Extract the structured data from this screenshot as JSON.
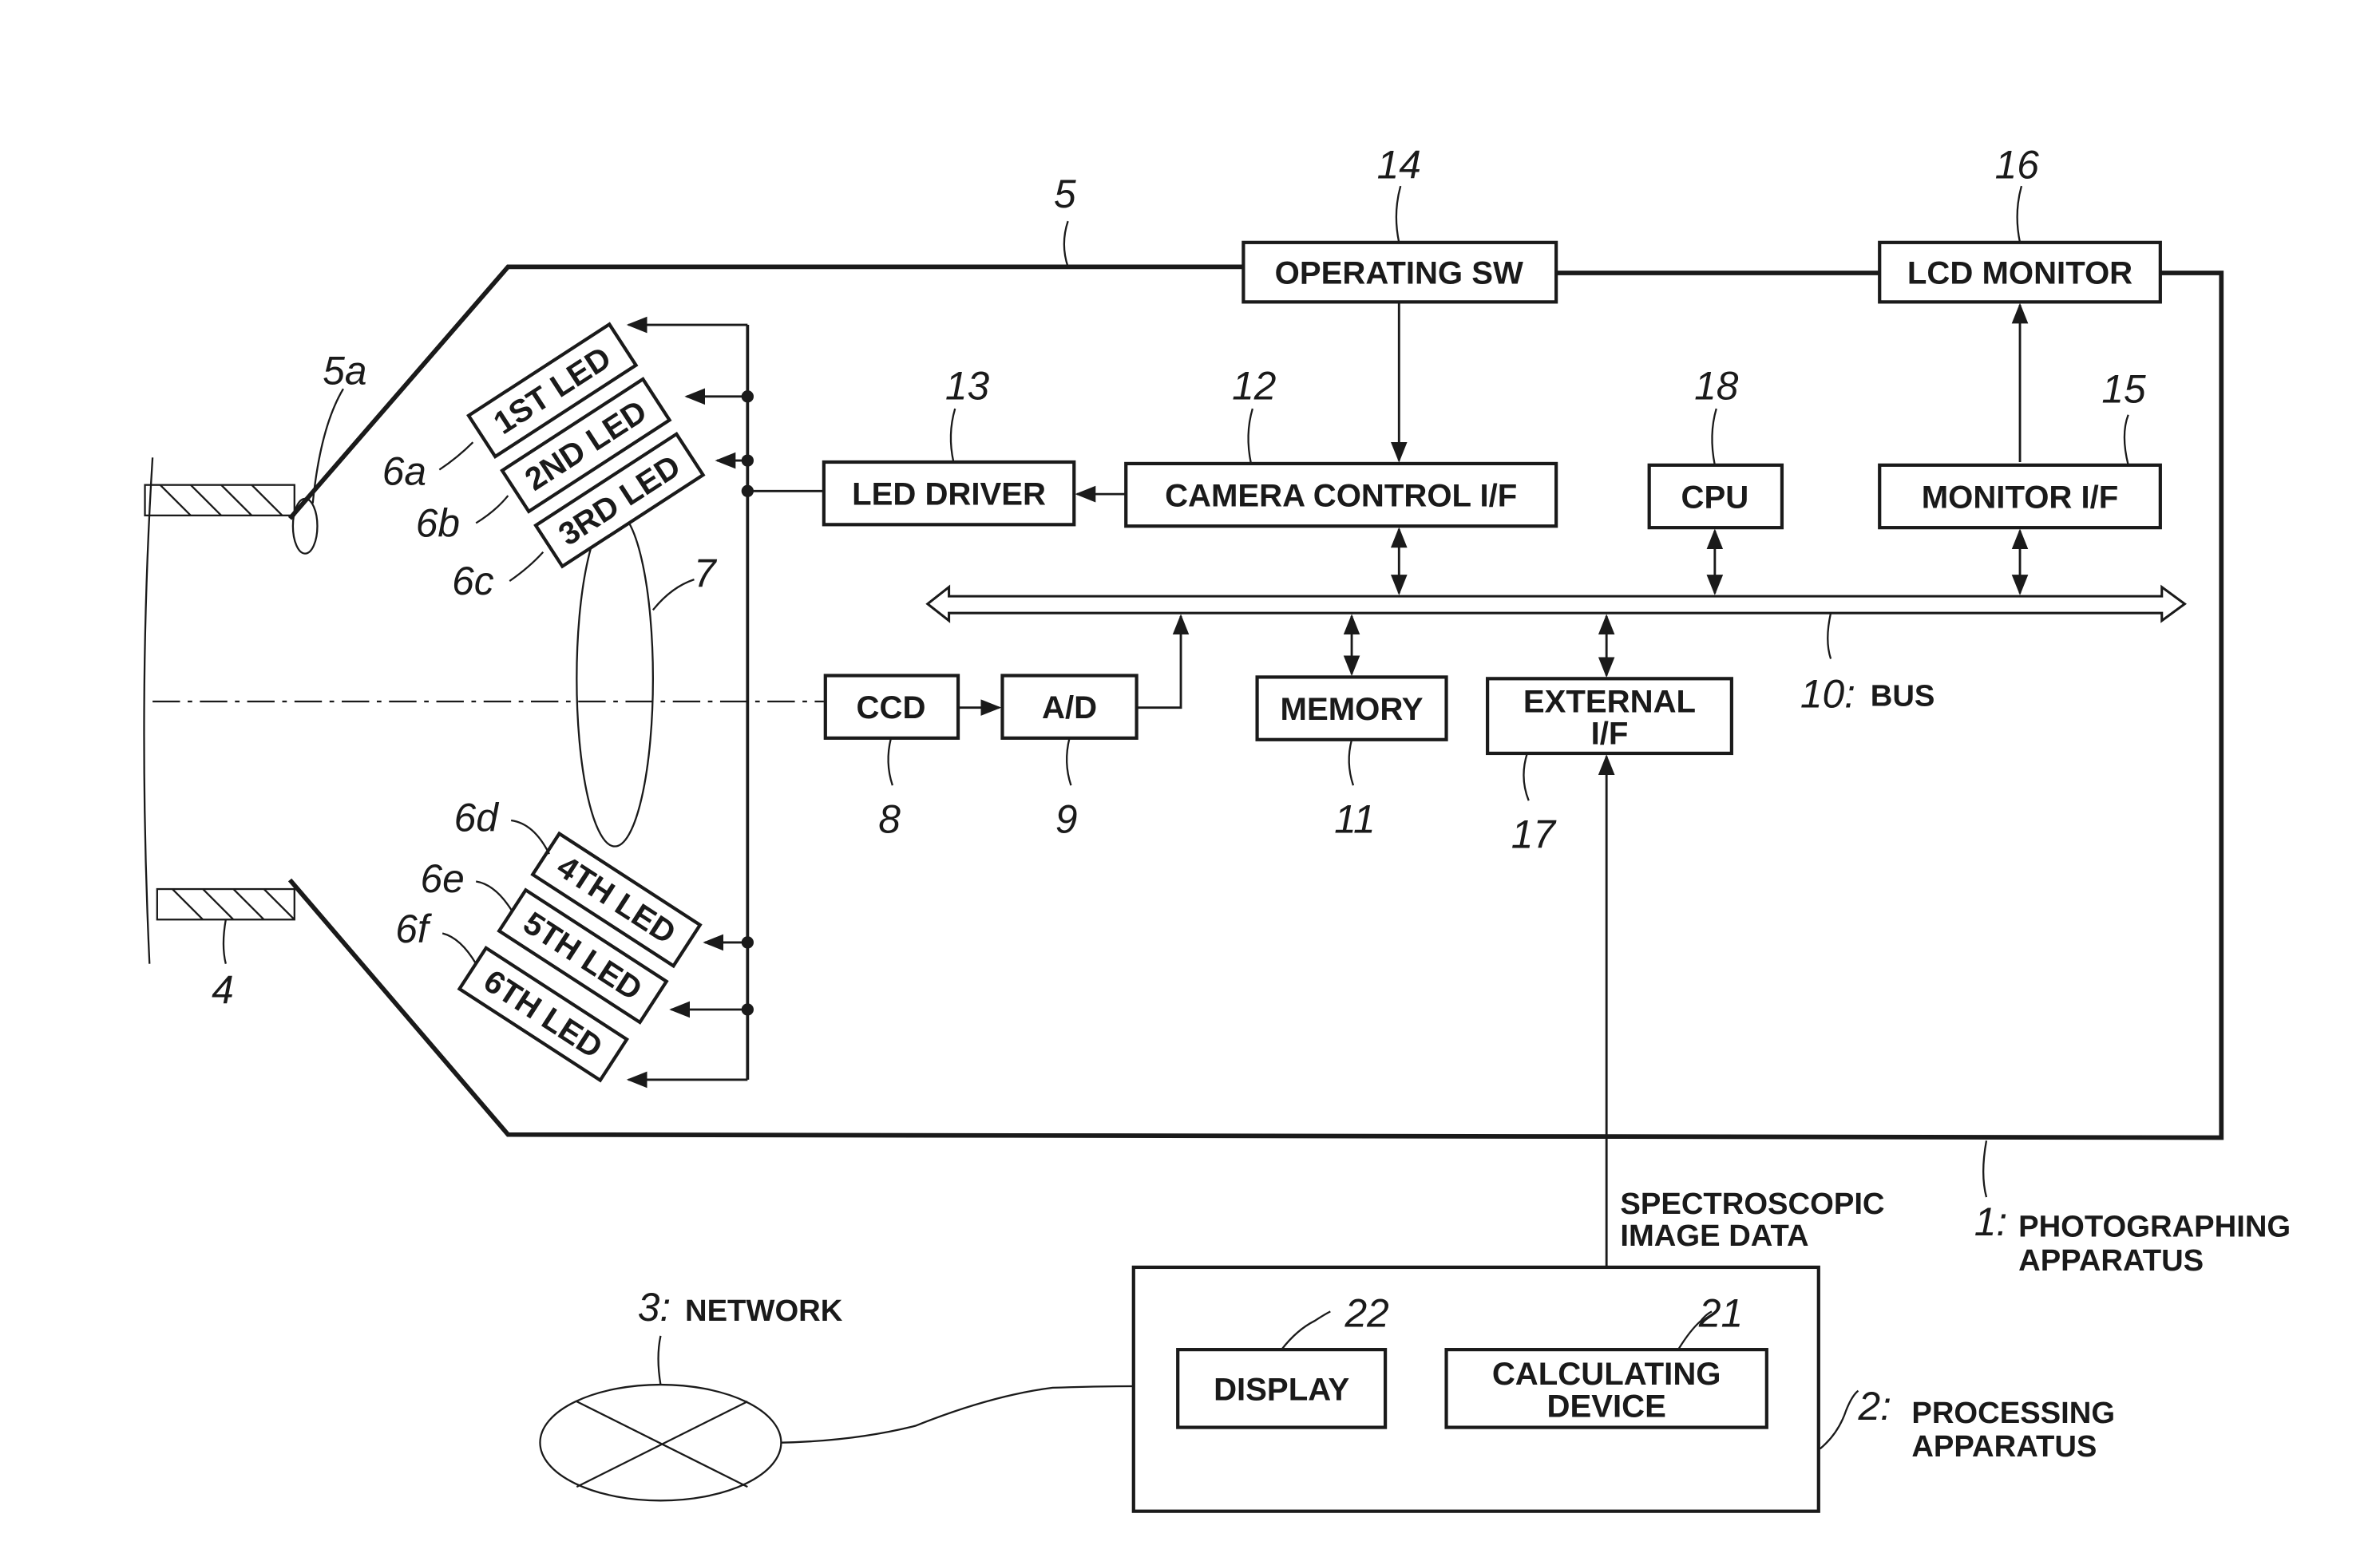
{
  "figure": {
    "housing": {
      "ref": "5",
      "opening_ref": "5a"
    },
    "object": {
      "ref": "4"
    },
    "lens": {
      "ref": "7"
    },
    "leds": [
      {
        "ref": "6a",
        "label": "1ST LED"
      },
      {
        "ref": "6b",
        "label": "2ND LED"
      },
      {
        "ref": "6c",
        "label": "3RD LED"
      },
      {
        "ref": "6d",
        "label": "4TH LED"
      },
      {
        "ref": "6e",
        "label": "5TH LED"
      },
      {
        "ref": "6f",
        "label": "6TH LED"
      }
    ],
    "blocks": {
      "operating_sw": {
        "ref": "14",
        "label": "OPERATING SW"
      },
      "lcd_monitor": {
        "ref": "16",
        "label": "LCD MONITOR"
      },
      "led_driver": {
        "ref": "13",
        "label": "LED DRIVER"
      },
      "camera_control": {
        "ref": "12",
        "label": "CAMERA CONTROL I/F"
      },
      "cpu": {
        "ref": "18",
        "label": "CPU"
      },
      "monitor_if": {
        "ref": "15",
        "label": "MONITOR I/F"
      },
      "ccd": {
        "ref": "8",
        "label": "CCD"
      },
      "ad": {
        "ref": "9",
        "label": "A/D"
      },
      "memory": {
        "ref": "11",
        "label": "MEMORY"
      },
      "external_if": {
        "ref": "17",
        "label_line1": "EXTERNAL",
        "label_line2": "I/F"
      },
      "display": {
        "ref": "22",
        "label": "DISPLAY"
      },
      "calculating": {
        "ref": "21",
        "label_line1": "CALCULATING",
        "label_line2": "DEVICE"
      }
    },
    "bus": {
      "ref": "10:",
      "label": "BUS"
    },
    "signal": {
      "line1": "SPECTROSCOPIC",
      "line2": "IMAGE DATA"
    },
    "photographing_apparatus": {
      "ref": "1:",
      "line1": "PHOTOGRAPHING",
      "line2": "APPARATUS"
    },
    "processing_apparatus": {
      "ref": "2:",
      "line1": "PROCESSING",
      "line2": "APPARATUS"
    },
    "network": {
      "ref": "3:",
      "label": "NETWORK"
    }
  }
}
